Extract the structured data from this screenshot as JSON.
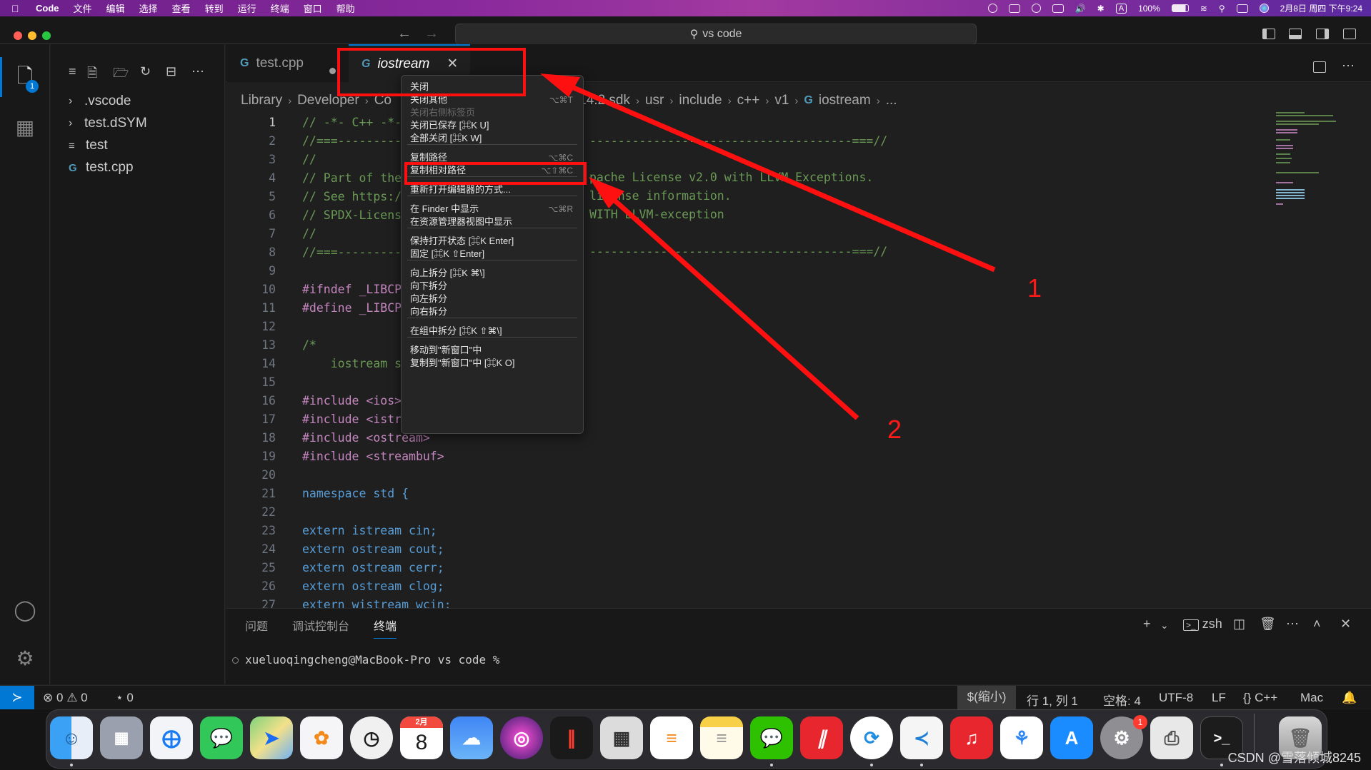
{
  "menubar": {
    "app_name": "Code",
    "menus": [
      "文件",
      "编辑",
      "选择",
      "查看",
      "转到",
      "运行",
      "终端",
      "窗口",
      "帮助"
    ],
    "input_indicator": "A",
    "battery": "100%",
    "datetime": "2月8日 周四 下午9:24"
  },
  "titlebar": {
    "search_text": "vs code"
  },
  "activity": {
    "explorer_badge": "1"
  },
  "explorer": {
    "items": [
      {
        "label": ".vscode",
        "kind": "folder"
      },
      {
        "label": "test.dSYM",
        "kind": "folder"
      },
      {
        "label": "test",
        "kind": "file"
      },
      {
        "label": "test.cpp",
        "kind": "cpp"
      }
    ]
  },
  "tabs": [
    {
      "label": "test.cpp",
      "dirty": true
    },
    {
      "label": "iostream",
      "active": true
    }
  ],
  "breadcrumb": [
    "Library",
    "Developer",
    "Co",
    "...X14.2.sdk",
    "usr",
    "include",
    "c++",
    "v1",
    "iostream",
    "..."
  ],
  "breadcrumb_visible": {
    "library": "Library",
    "developer": "Developer",
    "co": "Co",
    "sdk": "cX14.2.sdk",
    "usr": "usr",
    "include": "include",
    "cpp": "c++",
    "v1": "v1",
    "file": "iostream",
    "more": "..."
  },
  "editor": {
    "lines": [
      {
        "n": "1",
        "text": "// -*- C++ -*-"
      },
      {
        "n": "2",
        "text": "//===----------"
      },
      {
        "n": "3",
        "text": "//"
      },
      {
        "n": "4",
        "text": "// Part of the"
      },
      {
        "n": "5",
        "text": "// See https://"
      },
      {
        "n": "6",
        "text": "// SPDX-License"
      },
      {
        "n": "7",
        "text": "//"
      },
      {
        "n": "8",
        "text": "//===----------"
      },
      {
        "n": "9",
        "text": ""
      },
      {
        "n": "10",
        "text": "#ifndef _LIBCPP"
      },
      {
        "n": "11",
        "text": "#define _LIBCPP"
      },
      {
        "n": "12",
        "text": ""
      },
      {
        "n": "13",
        "text": "/*"
      },
      {
        "n": "14",
        "text": "    iostream sy"
      },
      {
        "n": "15",
        "text": ""
      },
      {
        "n": "16",
        "text": "#include <ios>"
      },
      {
        "n": "17",
        "text": "#include <istre"
      },
      {
        "n": "18",
        "text": "#include <ostream>"
      },
      {
        "n": "19",
        "text": "#include <streambuf>"
      },
      {
        "n": "20",
        "text": ""
      },
      {
        "n": "21",
        "text": "namespace std {"
      },
      {
        "n": "22",
        "text": ""
      },
      {
        "n": "23",
        "text": "extern istream cin;"
      },
      {
        "n": "24",
        "text": "extern ostream cout;"
      },
      {
        "n": "25",
        "text": "extern ostream cerr;"
      },
      {
        "n": "26",
        "text": "extern ostream clog;"
      },
      {
        "n": "27",
        "text": "extern wistream wcin;"
      }
    ],
    "right_fragments": {
      "l2": "-------------------------------------===//",
      "l4": "pache License v2.0 with LLVM Exceptions.",
      "l5": "license information.",
      "l6": "WITH LLVM-exception",
      "l8": "-------------------------------------===//"
    }
  },
  "context_menu": {
    "items": [
      {
        "label": "关闭",
        "kb": ""
      },
      {
        "label": "关闭其他",
        "kb": "⌥⌘T"
      },
      {
        "label": "关闭右侧标签页",
        "kb": "",
        "disabled": true
      },
      {
        "label": "关闭已保存 [⌘K U]",
        "kb": ""
      },
      {
        "label": "全部关闭 [⌘K W]",
        "kb": ""
      },
      {
        "label": "复制路径",
        "kb": "⌥⌘C"
      },
      {
        "label": "复制相对路径",
        "kb": "⌥⇧⌘C"
      },
      {
        "label": "重新打开编辑器的方式...",
        "kb": ""
      },
      {
        "label": "在 Finder 中显示",
        "kb": "⌥⌘R"
      },
      {
        "label": "在资源管理器视图中显示",
        "kb": ""
      },
      {
        "label": "保持打开状态 [⌘K Enter]",
        "kb": ""
      },
      {
        "label": "固定 [⌘K ⇧Enter]",
        "kb": ""
      },
      {
        "label": "向上拆分 [⌘K ⌘\\]",
        "kb": ""
      },
      {
        "label": "向下拆分",
        "kb": ""
      },
      {
        "label": "向左拆分",
        "kb": ""
      },
      {
        "label": "向右拆分",
        "kb": ""
      },
      {
        "label": "在组中拆分 [⌘K ⇧⌘\\]",
        "kb": ""
      },
      {
        "label": "移动到\"新窗口\"中",
        "kb": ""
      },
      {
        "label": "复制到\"新窗口\"中 [⌘K O]",
        "kb": ""
      }
    ]
  },
  "panel": {
    "tabs": [
      "问题",
      "调试控制台",
      "终端"
    ],
    "shell": "zsh",
    "prompt": "xueluoqingcheng@MacBook-Pro vs code %"
  },
  "statusbar": {
    "errors": "0",
    "warnings": "0",
    "ports": "0",
    "zoom": "$(缩小)",
    "position": "行 1, 列 1",
    "spaces": "空格: 4",
    "encoding": "UTF-8",
    "eol": "LF",
    "language": "C++",
    "platform": "Mac"
  },
  "dock": {
    "calendar_month": "2月",
    "calendar_day": "8",
    "settings_badge": "1"
  },
  "annotations": {
    "one": "1",
    "two": "2"
  },
  "watermark": "CSDN @雪落倾城8245",
  "colors": {
    "accent": "#0078d4",
    "annotation_red": "#ff1010",
    "editor_bg": "#1f1f1f"
  }
}
